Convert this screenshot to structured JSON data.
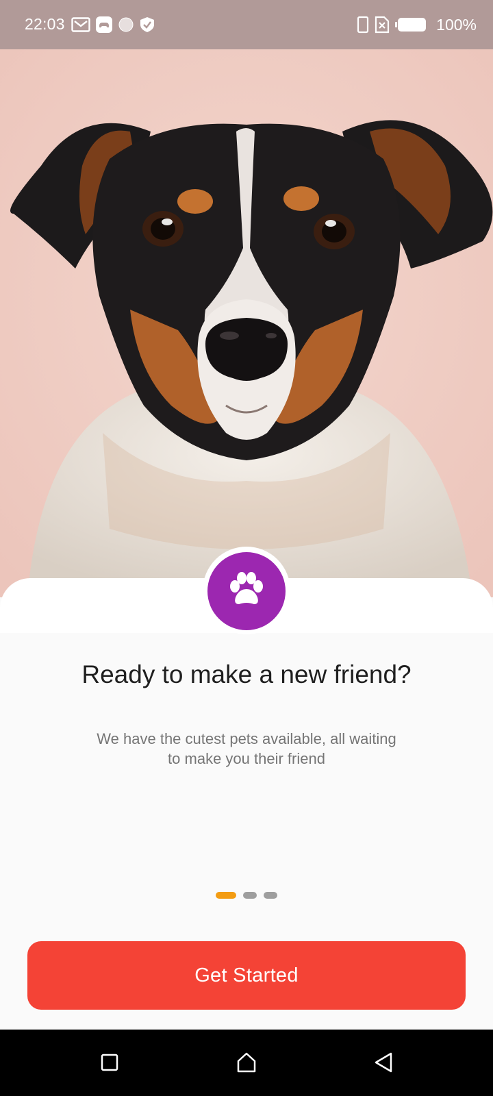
{
  "status_bar": {
    "time": "22:03",
    "left_icons": [
      "gmail-icon",
      "game-controller-icon",
      "circle-notification-icon",
      "shield-check-icon"
    ],
    "right_icons": [
      "phone-vibrate-icon",
      "no-sim-icon",
      "battery-icon"
    ],
    "battery_percent": "100%"
  },
  "hero": {
    "image_subject": "dog-photo",
    "background_color": "#f0cfc6"
  },
  "badge": {
    "icon": "paw-icon",
    "color": "#9c27b0"
  },
  "onboarding": {
    "headline": "Ready to make a new friend?",
    "subtext": "We have the cutest pets available, all waiting to make you their friend"
  },
  "pager": {
    "total_pages": 3,
    "current_page": 1,
    "active_color": "#f39c12",
    "inactive_color": "#9e9e9e"
  },
  "cta": {
    "label": "Get Started",
    "color": "#f44336"
  },
  "nav_bar": {
    "buttons": [
      "recents-square-icon",
      "home-icon",
      "back-triangle-icon"
    ]
  }
}
